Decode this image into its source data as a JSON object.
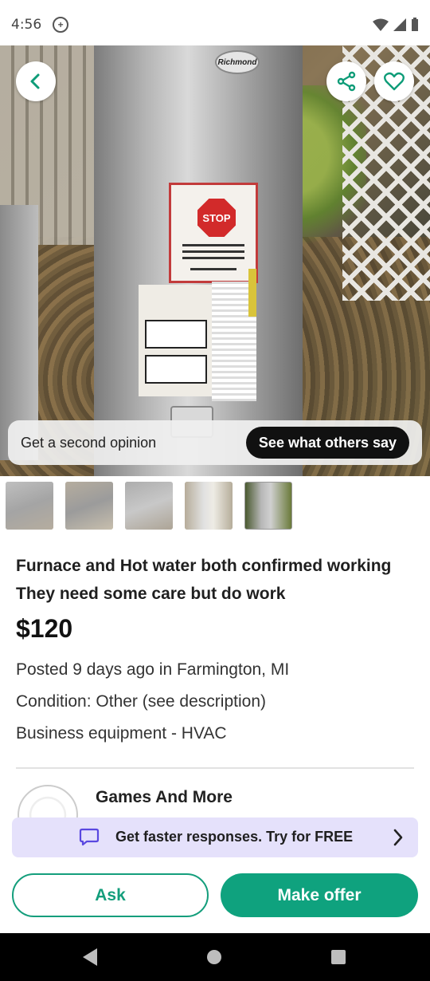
{
  "status_bar": {
    "time": "4:56"
  },
  "photo": {
    "brand_text": "Richmond",
    "sticker_text": "STOP"
  },
  "opinion": {
    "label": "Get a second opinion",
    "button": "See what others say"
  },
  "thumbnails": [
    "thumb-1",
    "thumb-2",
    "thumb-3",
    "thumb-4",
    "thumb-5"
  ],
  "listing": {
    "title": "Furnace and Hot water both confirmed working They need some care but do work",
    "price": "$120",
    "posted": "Posted 9 days ago in Farmington, MI",
    "condition": "Condition: Other (see description)",
    "category": "Business equipment - HVAC"
  },
  "seller": {
    "name": "Games And More"
  },
  "promo": {
    "text": "Get faster responses. Try for FREE"
  },
  "actions": {
    "ask": "Ask",
    "offer": "Make offer"
  },
  "colors": {
    "accent": "#0fa27e",
    "promo_bg": "#e5e1fb"
  },
  "icons": {
    "back": "chevron-left-icon",
    "share": "share-icon",
    "favorite": "heart-icon",
    "chat": "chat-bubble-icon",
    "arrow": "chevron-right-icon"
  }
}
